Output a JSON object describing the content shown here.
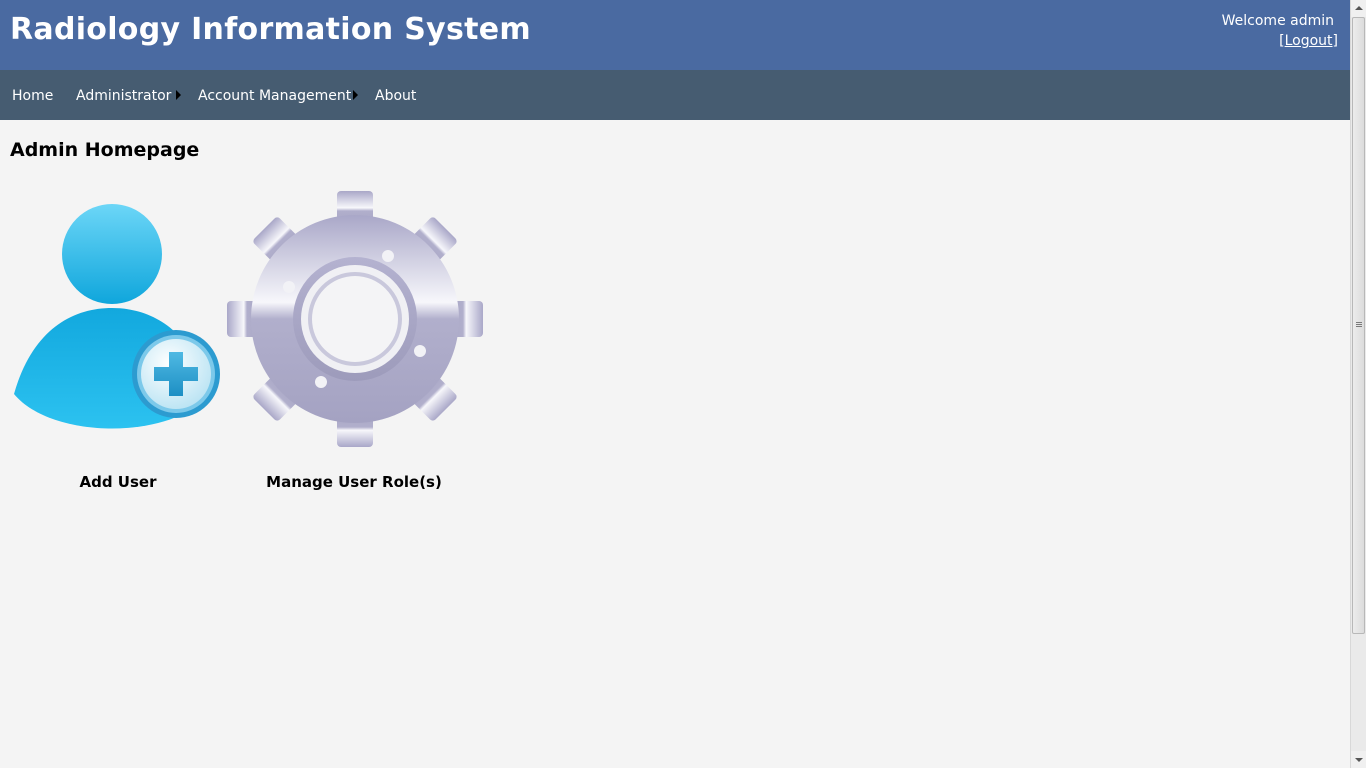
{
  "header": {
    "title": "Radiology Information System",
    "welcome_text": "Welcome admin",
    "logout_prefix": "[",
    "logout_label": "Logout",
    "logout_suffix": "]"
  },
  "menu": {
    "items": [
      {
        "label": "Home",
        "has_submenu": false
      },
      {
        "label": "Administrator",
        "has_submenu": true
      },
      {
        "label": "Account Management",
        "has_submenu": true
      },
      {
        "label": "About",
        "has_submenu": false
      }
    ]
  },
  "main": {
    "page_title": "Admin Homepage",
    "tiles": [
      {
        "label": "Add User",
        "icon": "add-user-icon"
      },
      {
        "label": "Manage User Role(s)",
        "icon": "gear-icon"
      }
    ]
  },
  "colors": {
    "header_bg": "#4a6aa1",
    "menu_bg": "#465c71",
    "page_bg": "#f4f4f4",
    "user_icon_blue": "#1ab4e6",
    "gear_gray": "#a9a7c6"
  }
}
